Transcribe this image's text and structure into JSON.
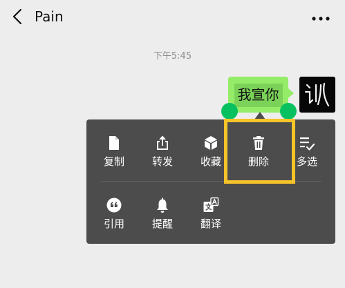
{
  "header": {
    "title": "Pain",
    "back_icon": "chevron-left-icon",
    "more_icon": "more-dots-icon"
  },
  "chat": {
    "timestamp": "下午5:45",
    "message": {
      "text": "我宣你",
      "bubble_color": "#95ec69",
      "selection_color": "#7bd258",
      "handle_color": "#07c160"
    },
    "avatar": {
      "text": "训",
      "background": "#070707"
    }
  },
  "context_menu": {
    "background": "#4c4c4c",
    "highlight_color": "#f6c32a",
    "highlighted_item": "删除",
    "row1": [
      {
        "label": "复制",
        "icon": "document-icon"
      },
      {
        "label": "转发",
        "icon": "share-icon"
      },
      {
        "label": "收藏",
        "icon": "cube-icon"
      },
      {
        "label": "删除",
        "icon": "trash-icon"
      },
      {
        "label": "多选",
        "icon": "checklist-icon"
      }
    ],
    "row2": [
      {
        "label": "引用",
        "icon": "quote-icon"
      },
      {
        "label": "提醒",
        "icon": "bell-icon"
      },
      {
        "label": "翻译",
        "icon": "translate-icon"
      }
    ]
  }
}
